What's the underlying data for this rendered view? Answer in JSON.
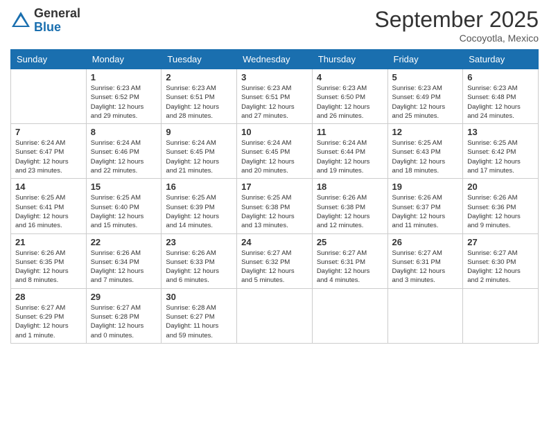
{
  "logo": {
    "general": "General",
    "blue": "Blue"
  },
  "header": {
    "month": "September 2025",
    "location": "Cocoyotla, Mexico"
  },
  "weekdays": [
    "Sunday",
    "Monday",
    "Tuesday",
    "Wednesday",
    "Thursday",
    "Friday",
    "Saturday"
  ],
  "weeks": [
    [
      {
        "day": "",
        "info": ""
      },
      {
        "day": "1",
        "info": "Sunrise: 6:23 AM\nSunset: 6:52 PM\nDaylight: 12 hours\nand 29 minutes."
      },
      {
        "day": "2",
        "info": "Sunrise: 6:23 AM\nSunset: 6:51 PM\nDaylight: 12 hours\nand 28 minutes."
      },
      {
        "day": "3",
        "info": "Sunrise: 6:23 AM\nSunset: 6:51 PM\nDaylight: 12 hours\nand 27 minutes."
      },
      {
        "day": "4",
        "info": "Sunrise: 6:23 AM\nSunset: 6:50 PM\nDaylight: 12 hours\nand 26 minutes."
      },
      {
        "day": "5",
        "info": "Sunrise: 6:23 AM\nSunset: 6:49 PM\nDaylight: 12 hours\nand 25 minutes."
      },
      {
        "day": "6",
        "info": "Sunrise: 6:23 AM\nSunset: 6:48 PM\nDaylight: 12 hours\nand 24 minutes."
      }
    ],
    [
      {
        "day": "7",
        "info": "Sunrise: 6:24 AM\nSunset: 6:47 PM\nDaylight: 12 hours\nand 23 minutes."
      },
      {
        "day": "8",
        "info": "Sunrise: 6:24 AM\nSunset: 6:46 PM\nDaylight: 12 hours\nand 22 minutes."
      },
      {
        "day": "9",
        "info": "Sunrise: 6:24 AM\nSunset: 6:45 PM\nDaylight: 12 hours\nand 21 minutes."
      },
      {
        "day": "10",
        "info": "Sunrise: 6:24 AM\nSunset: 6:45 PM\nDaylight: 12 hours\nand 20 minutes."
      },
      {
        "day": "11",
        "info": "Sunrise: 6:24 AM\nSunset: 6:44 PM\nDaylight: 12 hours\nand 19 minutes."
      },
      {
        "day": "12",
        "info": "Sunrise: 6:25 AM\nSunset: 6:43 PM\nDaylight: 12 hours\nand 18 minutes."
      },
      {
        "day": "13",
        "info": "Sunrise: 6:25 AM\nSunset: 6:42 PM\nDaylight: 12 hours\nand 17 minutes."
      }
    ],
    [
      {
        "day": "14",
        "info": "Sunrise: 6:25 AM\nSunset: 6:41 PM\nDaylight: 12 hours\nand 16 minutes."
      },
      {
        "day": "15",
        "info": "Sunrise: 6:25 AM\nSunset: 6:40 PM\nDaylight: 12 hours\nand 15 minutes."
      },
      {
        "day": "16",
        "info": "Sunrise: 6:25 AM\nSunset: 6:39 PM\nDaylight: 12 hours\nand 14 minutes."
      },
      {
        "day": "17",
        "info": "Sunrise: 6:25 AM\nSunset: 6:38 PM\nDaylight: 12 hours\nand 13 minutes."
      },
      {
        "day": "18",
        "info": "Sunrise: 6:26 AM\nSunset: 6:38 PM\nDaylight: 12 hours\nand 12 minutes."
      },
      {
        "day": "19",
        "info": "Sunrise: 6:26 AM\nSunset: 6:37 PM\nDaylight: 12 hours\nand 11 minutes."
      },
      {
        "day": "20",
        "info": "Sunrise: 6:26 AM\nSunset: 6:36 PM\nDaylight: 12 hours\nand 9 minutes."
      }
    ],
    [
      {
        "day": "21",
        "info": "Sunrise: 6:26 AM\nSunset: 6:35 PM\nDaylight: 12 hours\nand 8 minutes."
      },
      {
        "day": "22",
        "info": "Sunrise: 6:26 AM\nSunset: 6:34 PM\nDaylight: 12 hours\nand 7 minutes."
      },
      {
        "day": "23",
        "info": "Sunrise: 6:26 AM\nSunset: 6:33 PM\nDaylight: 12 hours\nand 6 minutes."
      },
      {
        "day": "24",
        "info": "Sunrise: 6:27 AM\nSunset: 6:32 PM\nDaylight: 12 hours\nand 5 minutes."
      },
      {
        "day": "25",
        "info": "Sunrise: 6:27 AM\nSunset: 6:31 PM\nDaylight: 12 hours\nand 4 minutes."
      },
      {
        "day": "26",
        "info": "Sunrise: 6:27 AM\nSunset: 6:31 PM\nDaylight: 12 hours\nand 3 minutes."
      },
      {
        "day": "27",
        "info": "Sunrise: 6:27 AM\nSunset: 6:30 PM\nDaylight: 12 hours\nand 2 minutes."
      }
    ],
    [
      {
        "day": "28",
        "info": "Sunrise: 6:27 AM\nSunset: 6:29 PM\nDaylight: 12 hours\nand 1 minute."
      },
      {
        "day": "29",
        "info": "Sunrise: 6:27 AM\nSunset: 6:28 PM\nDaylight: 12 hours\nand 0 minutes."
      },
      {
        "day": "30",
        "info": "Sunrise: 6:28 AM\nSunset: 6:27 PM\nDaylight: 11 hours\nand 59 minutes."
      },
      {
        "day": "",
        "info": ""
      },
      {
        "day": "",
        "info": ""
      },
      {
        "day": "",
        "info": ""
      },
      {
        "day": "",
        "info": ""
      }
    ]
  ]
}
